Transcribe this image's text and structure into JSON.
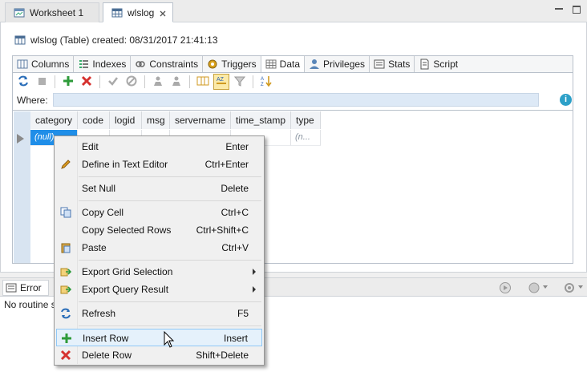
{
  "editor_tabs": [
    {
      "label": "Worksheet 1",
      "icon": "worksheet-icon",
      "active": false
    },
    {
      "label": "wlslog",
      "icon": "table-icon",
      "active": true,
      "closable": true
    }
  ],
  "header": {
    "created_text": "wlslog (Table) created: 08/31/2017 21:41:13"
  },
  "subtabs": [
    {
      "label": "Columns",
      "icon": "columns-icon"
    },
    {
      "label": "Indexes",
      "icon": "indexes-icon"
    },
    {
      "label": "Constraints",
      "icon": "constraints-icon"
    },
    {
      "label": "Triggers",
      "icon": "triggers-icon"
    },
    {
      "label": "Data",
      "icon": "data-grid-icon",
      "active": true
    },
    {
      "label": "Privileges",
      "icon": "privileges-icon"
    },
    {
      "label": "Stats",
      "icon": "stats-icon"
    },
    {
      "label": "Script",
      "icon": "script-icon"
    }
  ],
  "where": {
    "label": "Where:",
    "value": ""
  },
  "grid": {
    "columns": [
      "category",
      "code",
      "logid",
      "msg",
      "servername",
      "time_stamp",
      "type"
    ],
    "row1": {
      "category": "(null)",
      "type": "(n..."
    }
  },
  "context_menu": {
    "items": [
      {
        "label": "Edit",
        "shortcut": "Enter",
        "icon": ""
      },
      {
        "label": "Define in Text Editor",
        "shortcut": "Ctrl+Enter",
        "icon": "pencil-icon"
      },
      {
        "label": "Set Null",
        "shortcut": "Delete",
        "icon": ""
      },
      {
        "label": "Copy Cell",
        "shortcut": "Ctrl+C",
        "icon": "copy-icon"
      },
      {
        "label": "Copy Selected Rows",
        "shortcut": "Ctrl+Shift+C",
        "icon": ""
      },
      {
        "label": "Paste",
        "shortcut": "Ctrl+V",
        "icon": "paste-icon"
      },
      {
        "label": "Export Grid Selection",
        "shortcut": "",
        "icon": "export-icon",
        "submenu": true
      },
      {
        "label": "Export Query Result",
        "shortcut": "",
        "icon": "export-icon",
        "submenu": true
      },
      {
        "label": "Refresh",
        "shortcut": "F5",
        "icon": "refresh-icon"
      },
      {
        "label": "Insert Row",
        "shortcut": "Insert",
        "icon": "plus-icon",
        "hover": true
      },
      {
        "label": "Delete Row",
        "shortcut": "Shift+Delete",
        "icon": "x-icon"
      }
    ]
  },
  "bottom_panel": {
    "tab_label": "Error",
    "message": "No routine s"
  },
  "colors": {
    "accent": "#1f8ee8",
    "add_green": "#2e9b3a",
    "delete_red": "#d6322f",
    "info_blue": "#2da0c8",
    "menu_hover": "#e5f1fb"
  }
}
